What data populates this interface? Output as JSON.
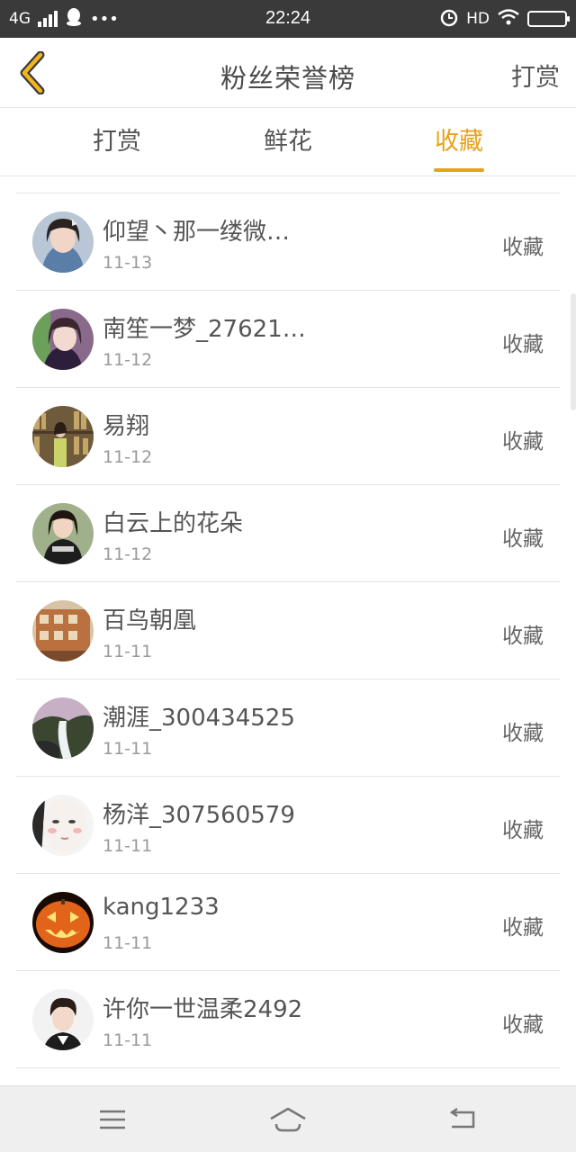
{
  "status_bar": {
    "network": "4G",
    "dots": "•••",
    "time": "22:24",
    "hd": "HD"
  },
  "header": {
    "title": "粉丝荣誉榜",
    "action_label": "打赏",
    "accent_color": "#e8a21a"
  },
  "tabs": [
    {
      "label": "打赏",
      "active": false
    },
    {
      "label": "鲜花",
      "active": false
    },
    {
      "label": "收藏",
      "active": true
    }
  ],
  "fans": [
    {
      "name": "仰望丶那一缕微…",
      "date": "11-13",
      "action": "收藏",
      "avatar": "girl-portrait"
    },
    {
      "name": "南笙一梦_27621…",
      "date": "11-12",
      "action": "收藏",
      "avatar": "girl-portrait"
    },
    {
      "name": "易翔",
      "date": "11-12",
      "action": "收藏",
      "avatar": "bookshelf-photo"
    },
    {
      "name": "白云上的花朵",
      "date": "11-12",
      "action": "收藏",
      "avatar": "girl-portrait"
    },
    {
      "name": "百鸟朝凰",
      "date": "11-11",
      "action": "收藏",
      "avatar": "building-photo"
    },
    {
      "name": "潮涯_300434525",
      "date": "11-11",
      "action": "收藏",
      "avatar": "waterfall-photo"
    },
    {
      "name": "杨洋_307560579",
      "date": "11-11",
      "action": "收藏",
      "avatar": "face-portrait"
    },
    {
      "name": "kang1233",
      "date": "11-11",
      "action": "收藏",
      "avatar": "pumpkin-photo"
    },
    {
      "name": "许你一世温柔2492",
      "date": "11-11",
      "action": "收藏",
      "avatar": "boy-portrait"
    }
  ],
  "nav": {
    "menu_icon": "menu-icon",
    "home_icon": "home-icon",
    "back_icon": "return-icon"
  }
}
